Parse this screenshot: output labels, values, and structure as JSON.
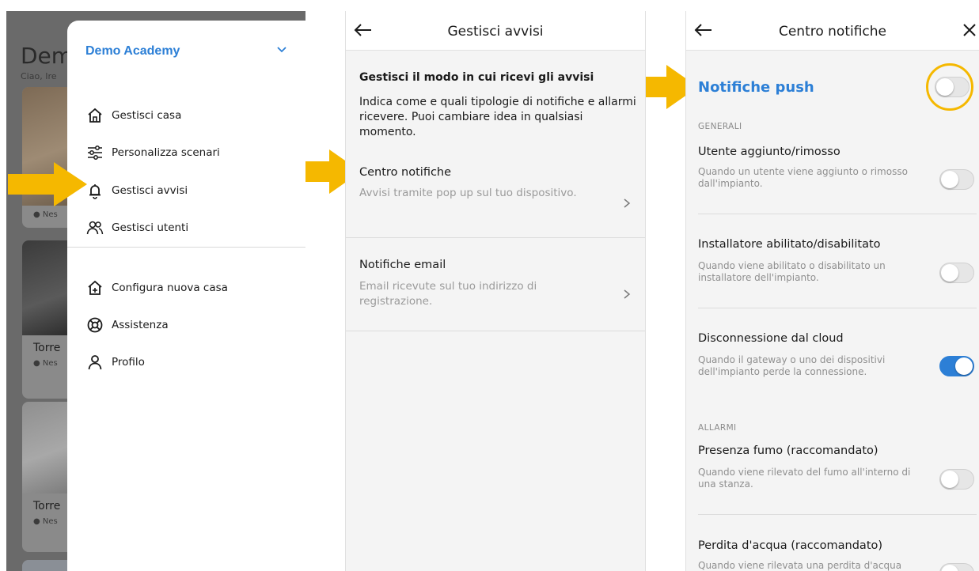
{
  "colors": {
    "accent": "#2c7fd6",
    "arrow": "#f5b800",
    "toggle_on": "#2c7fd6"
  },
  "panel1": {
    "background_title": "Dem",
    "background_subtitle": "Ciao, Ire",
    "cards": [
      {
        "label": "",
        "status": ""
      },
      {
        "label": "",
        "status": "● Nes"
      },
      {
        "label": "Torre",
        "status": "● Nes"
      },
      {
        "label": "Torre",
        "status": "● Nes"
      }
    ],
    "drawer": {
      "title": "Demo Academy",
      "items": [
        {
          "label": "Gestisci casa",
          "icon": "home-icon"
        },
        {
          "label": "Personalizza scenari",
          "icon": "sliders-icon"
        },
        {
          "label": "Gestisci avvisi",
          "icon": "bell-icon"
        },
        {
          "label": "Gestisci utenti",
          "icon": "users-icon"
        }
      ],
      "items2": [
        {
          "label": "Configura nuova casa",
          "icon": "home-add-icon"
        },
        {
          "label": "Assistenza",
          "icon": "lifebuoy-icon"
        },
        {
          "label": "Profilo",
          "icon": "user-icon"
        }
      ]
    }
  },
  "panel2": {
    "title": "Gestisci avvisi",
    "intro_heading": "Gestisci il modo in cui ricevi gli avvisi",
    "intro_text": "Indica come e quali tipologie di notifiche e allarmi ricevere. Puoi cambiare idea in qualsiasi momento.",
    "options": [
      {
        "title": "Centro notifiche",
        "desc": "Avvisi tramite pop up sul tuo dispositivo."
      },
      {
        "title": "Notifiche email",
        "desc": "Email ricevute sul tuo indirizzo di registrazione."
      }
    ]
  },
  "panel3": {
    "title": "Centro notifiche",
    "push_label": "Notifiche push",
    "push_on": false,
    "section_general": "GENERALI",
    "section_alarms": "ALLARMI",
    "rows": [
      {
        "title": "Utente aggiunto/rimosso",
        "desc": "Quando un utente viene aggiunto o rimosso dall'impianto.",
        "on": false
      },
      {
        "title": "Installatore abilitato/disabilitato",
        "desc": "Quando viene abilitato o disabilitato un installatore dell'impianto.",
        "on": false
      },
      {
        "title": "Disconnessione dal cloud",
        "desc": "Quando il gateway o uno dei dispositivi dell'impianto perde la connessione.",
        "on": true
      },
      {
        "title": "Presenza fumo (raccomandato)",
        "desc": "Quando viene rilevato del fumo all'interno di una stanza.",
        "on": false
      },
      {
        "title": "Perdita d'acqua (raccomandato)",
        "desc": "Quando viene rilevata una perdita d'acqua",
        "on": false
      }
    ]
  }
}
